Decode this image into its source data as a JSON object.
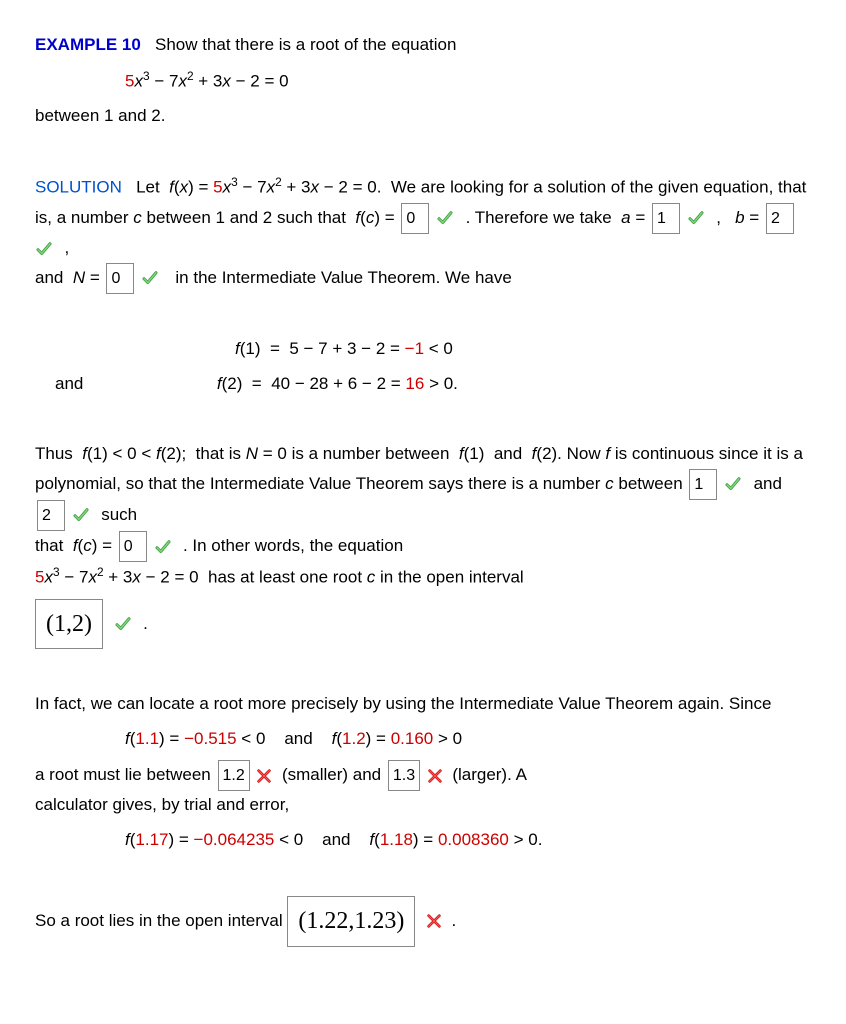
{
  "header": {
    "example_label": "EXAMPLE 10",
    "prompt": "Show that there is a root of the equation",
    "equation_lead": "5",
    "equation_rest": "x³ − 7x² + 3x − 2 = 0",
    "between_text": "between 1 and 2."
  },
  "sol": {
    "label": "SOLUTION",
    "let_pre": "Let",
    "let_fx": "f(x) = ",
    "let_5": "5",
    "let_rest": "x³ − 7x² + 3x − 2 = 0.",
    "look": "We are looking for a",
    "line2": "solution of the given equation, that is, a number",
    "c": "c",
    "line2b": "between 1 and 2 such",
    "line3a": "that",
    "fc": "f(c) =",
    "inp_fc": "0",
    "therefore": ". Therefore we take",
    "a_eq": "a =",
    "inp_a": "1",
    "comma": ",",
    "b_eq": "b =",
    "inp_b": "2",
    "and_N": "and",
    "N_eq": "N =",
    "inp_N": "0",
    "in_ivt": "in the Intermediate Value Theorem. We have"
  },
  "calc": {
    "f1_lhs": "f(1)",
    "eq": " = ",
    "f1_mid": "5 − 7 + 3 − 2 = ",
    "f1_res": "−1",
    "f1_tail": " < 0",
    "and": "and",
    "f2_lhs": "f(2)",
    "f2_mid": "40 − 28 + 6 − 2 = ",
    "f2_res": "16",
    "f2_tail": " > 0."
  },
  "p2": {
    "thus": "Thus",
    "cond": "f(1) < 0 < f(2);",
    "that_is": "that is",
    "N0": "N = 0",
    "is_num": "is a number between",
    "f1": "f(1)",
    "and": "and",
    "f2": "f(2).",
    "now": "Now",
    "f": "f",
    "cont": "is continuous since it is a polynomial, so that the Intermediate Value",
    "says": "Theorem says there is a number",
    "c": "c",
    "between": "between",
    "inp_c1": "1",
    "andw": "and",
    "inp_c2": "2",
    "such": "such",
    "that": "that",
    "fc": "f(c) =",
    "inp_fc2": "0",
    "inother": ". In other words, the equation",
    "eq5": "5",
    "eq_rest": "x³ − 7x² + 3x − 2 = 0",
    "has_root": "has at least one root",
    "c2": "c",
    "in_open": "in the open interval",
    "interval": "(1,2)",
    "dot": "."
  },
  "p3": {
    "infact": "In fact, we can locate a root more precisely by using the Intermediate Value Theorem again. Since",
    "f11_l": "f(",
    "a11": "1.1",
    "f11_r": ") = ",
    "v11": "−0.515",
    "lt0": " < 0",
    "and": "and",
    "f12_l": "f(",
    "a12": "1.2",
    "f12_r": ") = ",
    "v12": "0.160",
    "gt0": " > 0",
    "root_between": "a root must lie between",
    "inp_r1": "1.2",
    "smaller": "(smaller) and",
    "inp_r2": "1.3",
    "larger": "(larger). A",
    "calc_gives": "calculator gives, by trial and error,",
    "f117_l": "f(",
    "a117": "1.17",
    "f117_r": ") = ",
    "v117": "−0.064235",
    "and2": "and",
    "f118_l": "f(",
    "a118": "1.18",
    "f118_r": ") = ",
    "v118": "0.008360",
    "gt02": " > 0.",
    "so_root": "So a root lies in the open interval",
    "interval2": "(1.22,1.23)",
    "dot": "."
  }
}
